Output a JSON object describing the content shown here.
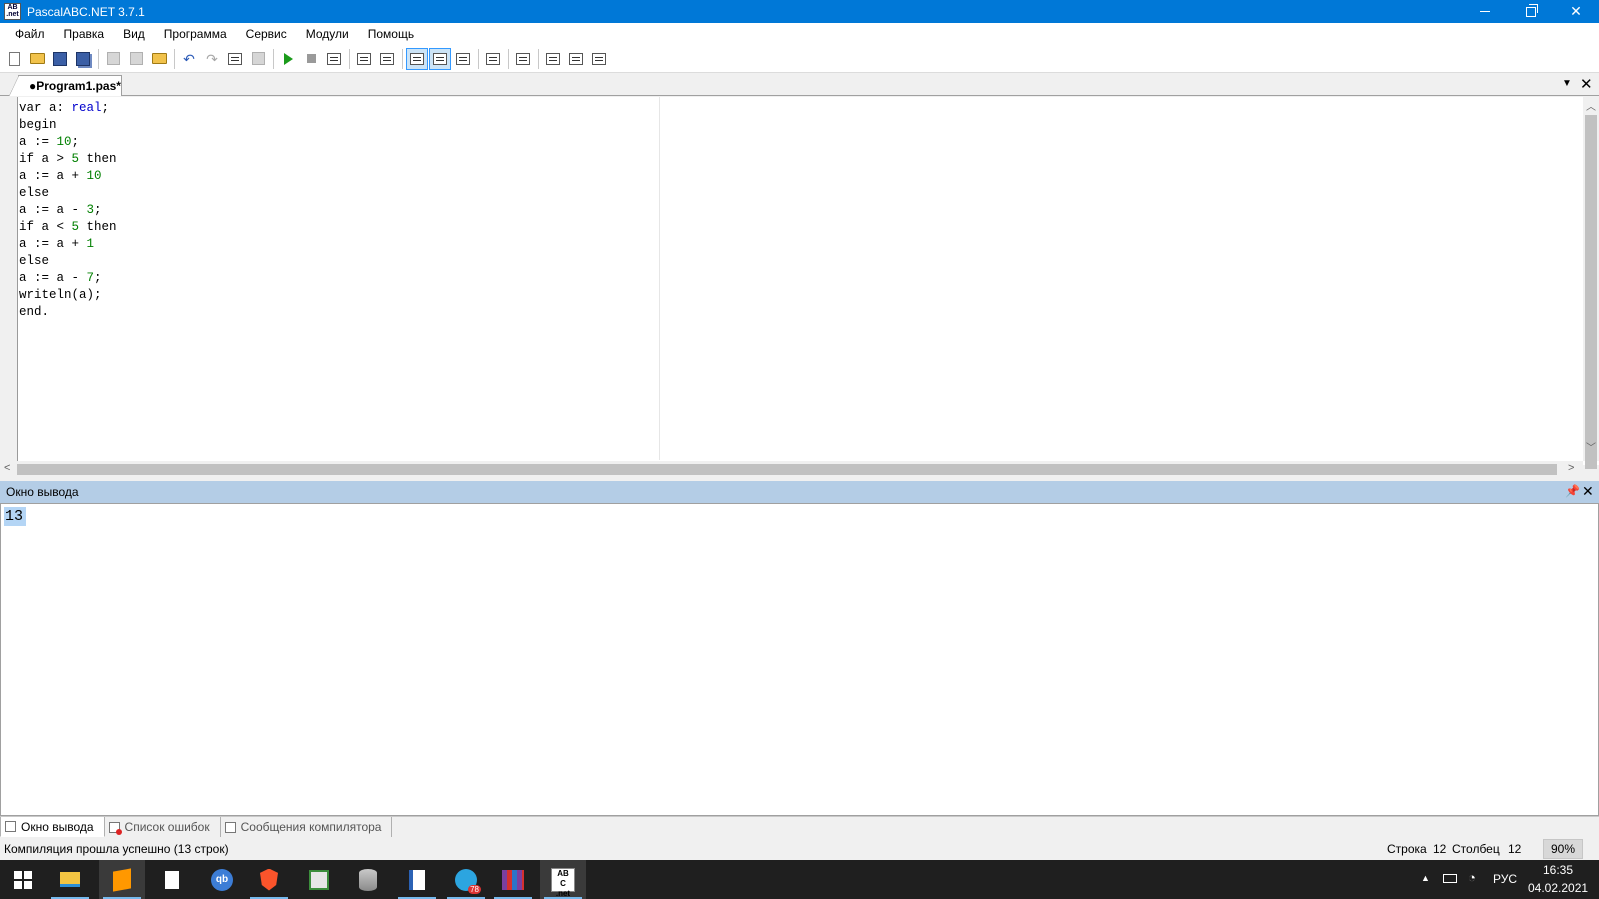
{
  "window": {
    "title": "PascalABC.NET 3.7.1",
    "icon_text": [
      "AB",
      ".net"
    ]
  },
  "menu": [
    {
      "label": "Файл"
    },
    {
      "label": "Правка"
    },
    {
      "label": "Вид"
    },
    {
      "label": "Программа"
    },
    {
      "label": "Сервис"
    },
    {
      "label": "Модули"
    },
    {
      "label": "Помощь"
    }
  ],
  "toolbar": {
    "buttons": [
      "new-file-icon",
      "open-folder-icon",
      "save-icon",
      "save-all-icon",
      "cut-icon",
      "copy-icon",
      "paste-icon",
      "undo-icon",
      "redo-icon",
      "step-icon",
      "step-over-icon",
      "run-icon",
      "stop-icon",
      "debug-icon"
    ]
  },
  "editor": {
    "tab_label": "●Program1.pas*",
    "code_lines": [
      [
        {
          "t": "var a: ",
          "c": "kw"
        },
        {
          "t": "real",
          "c": "ty"
        },
        {
          "t": ";",
          "c": "kw"
        }
      ],
      [
        {
          "t": "begin",
          "c": "kw"
        }
      ],
      [
        {
          "t": "a := ",
          "c": "kw"
        },
        {
          "t": "10",
          "c": "num"
        },
        {
          "t": ";",
          "c": "kw"
        }
      ],
      [
        {
          "t": "if a > ",
          "c": "kw"
        },
        {
          "t": "5",
          "c": "num"
        },
        {
          "t": " then",
          "c": "kw"
        }
      ],
      [
        {
          "t": "a := a + ",
          "c": "kw"
        },
        {
          "t": "10",
          "c": "num"
        }
      ],
      [
        {
          "t": "else",
          "c": "kw"
        }
      ],
      [
        {
          "t": "a := a - ",
          "c": "kw"
        },
        {
          "t": "3",
          "c": "num"
        },
        {
          "t": ";",
          "c": "kw"
        }
      ],
      [
        {
          "t": "if a < ",
          "c": "kw"
        },
        {
          "t": "5",
          "c": "num"
        },
        {
          "t": " then",
          "c": "kw"
        }
      ],
      [
        {
          "t": "a := a + ",
          "c": "kw"
        },
        {
          "t": "1",
          "c": "num"
        }
      ],
      [
        {
          "t": "else",
          "c": "kw"
        }
      ],
      [
        {
          "t": "a := a - ",
          "c": "kw"
        },
        {
          "t": "7",
          "c": "num"
        },
        {
          "t": ";",
          "c": "kw"
        }
      ],
      [
        {
          "t": "writeln(a);",
          "c": "kw"
        }
      ],
      [
        {
          "t": "end.",
          "c": "kw"
        }
      ]
    ]
  },
  "output": {
    "header": "Окно вывода",
    "text": "13"
  },
  "bottom_tabs": [
    {
      "label": "Окно вывода",
      "active": true
    },
    {
      "label": "Список ошибок",
      "active": false
    },
    {
      "label": "Сообщения компилятора",
      "active": false
    }
  ],
  "status": {
    "message": "Компиляция прошла успешно (13 строк)",
    "row_label": "Строка",
    "row_value": "12",
    "col_label": "Столбец",
    "col_value": "12",
    "zoom": "90%"
  },
  "taskbar": {
    "qb_label": "qb",
    "telegram_badge": "78",
    "abc_label": [
      "AB",
      "C",
      ".net"
    ],
    "lang": "РУС",
    "time": "16:35",
    "date": "04.02.2021"
  }
}
